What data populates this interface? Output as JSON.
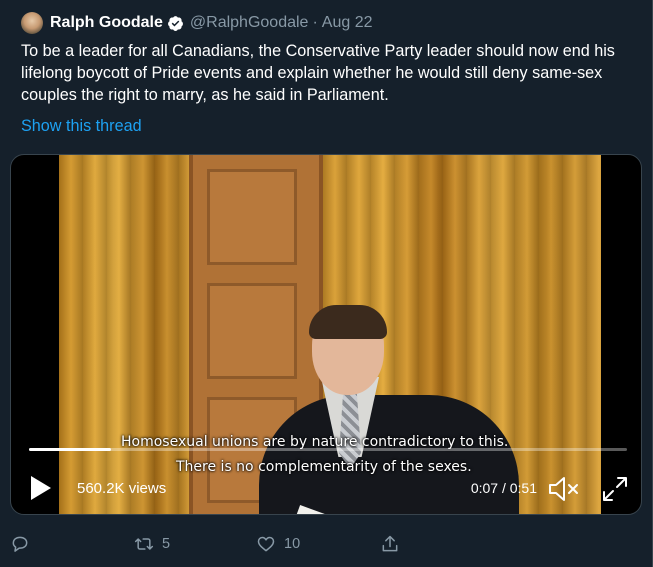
{
  "tweet": {
    "display_name": "Ralph Goodale",
    "handle": "@RalphGoodale",
    "separator": "·",
    "date": "Aug 22",
    "text": "To be a leader for all Canadians, the Conservative Party leader should now end his lifelong boycott of Pride events and explain whether he would still deny same-sex couples the right to marry, as he said in Parliament.",
    "show_thread": "Show this thread"
  },
  "video": {
    "subtitle_line_1": "Homosexual unions are by nature contradictory to this.",
    "subtitle_line_2": "There is no complementarity of the sexes.",
    "views": "560.2K views",
    "time": "0:07 / 0:51",
    "progress_fraction": 0.137
  },
  "actions": {
    "reply_count": "",
    "retweet_count": "5",
    "like_count": "10",
    "share_count": ""
  },
  "colors": {
    "background": "#15202b",
    "link": "#1da1f2",
    "secondary_text": "#8899a6"
  },
  "icons": [
    "avatar",
    "verified-badge-icon",
    "play-icon",
    "mute-icon",
    "fullscreen-icon",
    "reply-icon",
    "retweet-icon",
    "like-icon",
    "share-icon"
  ]
}
